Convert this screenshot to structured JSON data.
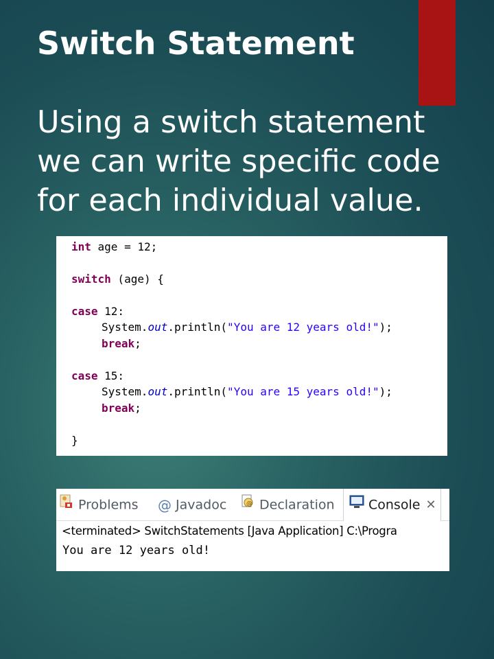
{
  "slide": {
    "title": "Switch Statement",
    "body": "Using a switch statement we can write specific code for each individual value."
  },
  "colors": {
    "accent_bar": "#a81414",
    "keyword": "#7f0055",
    "string": "#2a00ff",
    "static_field": "#0000c0"
  },
  "code": {
    "line1": {
      "keyword": "int",
      "rest": " age = 12;"
    },
    "line2": {
      "keyword": "switch",
      "rest": " (age) {"
    },
    "case1": {
      "keyword": "case",
      "rest": " 12:"
    },
    "print1": {
      "prefix": "System.",
      "field": "out",
      "mid": ".println(",
      "string": "\"You are 12 years old!\"",
      "suffix": ");"
    },
    "break1": {
      "keyword": "break",
      "rest": ";"
    },
    "case2": {
      "keyword": "case",
      "rest": " 15:"
    },
    "print2": {
      "prefix": "System.",
      "field": "out",
      "mid": ".println(",
      "string": "\"You are 15 years old!\"",
      "suffix": ");"
    },
    "break2": {
      "keyword": "break",
      "rest": ";"
    },
    "closing": "}"
  },
  "console_view": {
    "tabs": [
      {
        "label": "Problems",
        "icon": "problems-icon"
      },
      {
        "label": "Javadoc",
        "icon": "at-sign-icon"
      },
      {
        "label": "Declaration",
        "icon": "declaration-icon"
      },
      {
        "label": "Console",
        "icon": "console-icon",
        "active": true
      }
    ],
    "close_glyph": "✕",
    "at_glyph": "@",
    "terminated_text": "<terminated> SwitchStatements [Java Application] C:\\Progra",
    "output": "You are 12 years old!"
  }
}
